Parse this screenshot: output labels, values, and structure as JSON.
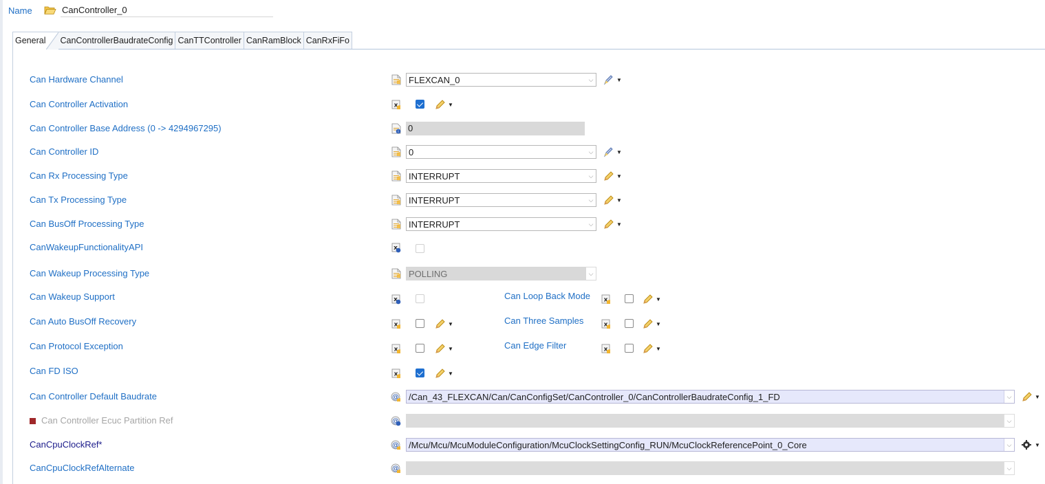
{
  "name_label": "Name",
  "name_value": "CanController_0",
  "tabs": [
    "General",
    "CanControllerBaudrateConfig",
    "CanTTController",
    "CanRamBlock",
    "CanRxFiFo"
  ],
  "rows": {
    "hw_channel": {
      "label": "Can Hardware Channel",
      "value": "FLEXCAN_0"
    },
    "activation": {
      "label": "Can Controller Activation",
      "checked": true
    },
    "base_address": {
      "label": "Can Controller Base Address (0 -> 4294967295)",
      "value": "0"
    },
    "controller_id": {
      "label": "Can Controller ID",
      "value": "0"
    },
    "rx_type": {
      "label": "Can Rx Processing Type",
      "value": "INTERRUPT"
    },
    "tx_type": {
      "label": "Can Tx Processing Type",
      "value": "INTERRUPT"
    },
    "busoff_type": {
      "label": "Can BusOff Processing Type",
      "value": "INTERRUPT"
    },
    "wakeup_api": {
      "label": "CanWakeupFunctionalityAPI",
      "checked": false
    },
    "wakeup_type": {
      "label": "Can Wakeup Processing Type",
      "value": "POLLING"
    },
    "wakeup_support": {
      "label": "Can Wakeup Support",
      "checked": false
    },
    "loop_back": {
      "label": "Can Loop Back Mode",
      "checked": false
    },
    "auto_busoff": {
      "label": "Can Auto BusOff Recovery",
      "checked": false
    },
    "three_samples": {
      "label": "Can Three Samples",
      "checked": false
    },
    "protocol_exception": {
      "label": "Can Protocol Exception",
      "checked": false
    },
    "edge_filter": {
      "label": "Can Edge Filter",
      "checked": false
    },
    "fd_iso": {
      "label": "Can FD ISO",
      "checked": true
    },
    "default_baudrate": {
      "label": "Can Controller Default Baudrate",
      "value": "/Can_43_FLEXCAN/Can/CanConfigSet/CanController_0/CanControllerBaudrateConfig_1_FD"
    },
    "ecuc_partition": {
      "label": "Can Controller Ecuc Partition Ref",
      "value": ""
    },
    "cpu_clock_ref": {
      "label": "CanCpuClockRef*",
      "value": "/Mcu/Mcu/McuModuleConfiguration/McuClockSettingConfig_RUN/McuClockReferencePoint_0_Core"
    },
    "cpu_clock_alt": {
      "label": "CanCpuClockRefAlternate",
      "value": ""
    }
  },
  "colors": {
    "label_blue": "#1f6fc5",
    "check_blue": "#1e6fd0",
    "ref_bg": "#e6e8fb",
    "disabled_gray": "#d9d9d9"
  }
}
